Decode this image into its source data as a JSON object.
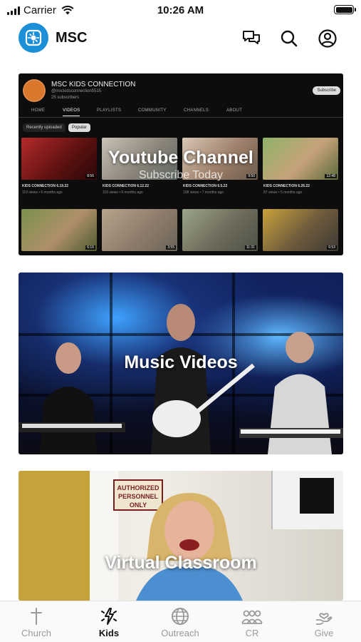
{
  "status_bar": {
    "carrier": "Carrier",
    "time": "10:26 AM"
  },
  "header": {
    "app_title": "MSC",
    "logo_icon": "msc-logo-icon",
    "actions": [
      "chat-icon",
      "search-icon",
      "account-icon"
    ]
  },
  "feed": {
    "youtube": {
      "title": "Youtube Channel",
      "subtitle": "Subscribe Today",
      "preview": {
        "channel_name": "MSC KIDS CONNECTION",
        "handle": "@msckidsconnection5515",
        "subscribers": "25 subscribers",
        "subscribe_label": "Subscribe",
        "tabs": [
          "HOME",
          "VIDEOS",
          "PLAYLISTS",
          "COMMUNITY",
          "CHANNELS",
          "ABOUT"
        ],
        "active_tab": "VIDEOS",
        "chips": [
          "Recently uploaded",
          "Popular"
        ],
        "videos_row1": [
          {
            "title": "KIDS CONNECTION 6.19.22",
            "meta": "119 views • 6 months ago",
            "duration": "8:56"
          },
          {
            "title": "KIDS CONNECTION 6.12.22",
            "meta": "110 views • 6 months ago",
            "duration": ""
          },
          {
            "title": "KIDS CONNECTION 6.5.22",
            "meta": "108 views • 7 months ago",
            "duration": "9:50"
          },
          {
            "title": "KIDS CONNECTION 6.26.22",
            "meta": "87 views • 5 months ago",
            "duration": "12:48"
          }
        ],
        "videos_row2_durations": [
          "6:16",
          "3:55",
          "11:31",
          "6:53"
        ]
      }
    },
    "music": {
      "title": "Music Videos"
    },
    "classroom": {
      "title": "Virtual Classroom",
      "sign_text": "AUTHORIZED PERSONNEL ONLY"
    }
  },
  "tab_bar": {
    "items": [
      {
        "label": "Church",
        "icon": "cross-icon"
      },
      {
        "label": "Kids",
        "icon": "kids-icon"
      },
      {
        "label": "Outreach",
        "icon": "globe-icon"
      },
      {
        "label": "CR",
        "icon": "group-icon"
      },
      {
        "label": "Give",
        "icon": "give-hand-icon"
      }
    ],
    "active": "Kids"
  },
  "colors": {
    "accent": "#1b8fd8",
    "active_tab": "#111111",
    "inactive_tab": "#9a9a9a"
  }
}
